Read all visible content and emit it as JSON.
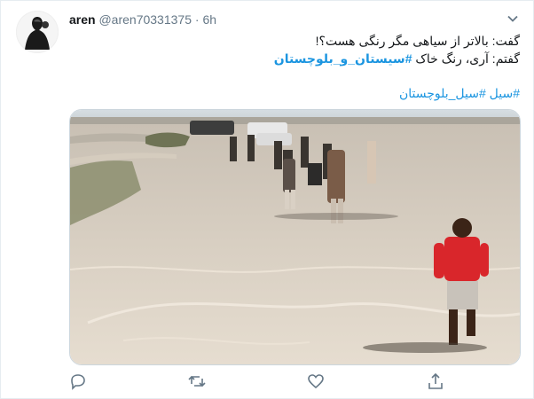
{
  "tweet": {
    "author_name": "aren",
    "author_handle": "@aren70331375",
    "separator": "·",
    "time": "6h",
    "line1": "گفت: بالاتر از سیاهی مگر رنگی هست؟!",
    "line2_prefix": "گفتم: آری، رنگ خاک ",
    "line2_hashtag": "#سیستان_و_بلوچستان",
    "hashtag1": "#سیل",
    "hashtag2": "#سیل_بلوچستان"
  },
  "media": {
    "description_icon": "photo"
  },
  "actions": [
    "reply-icon",
    "retweet-icon",
    "like-icon",
    "share-icon"
  ],
  "colors": {
    "link": "#1b95e0",
    "secondary": "#657786",
    "border": "#e6ecf0"
  }
}
